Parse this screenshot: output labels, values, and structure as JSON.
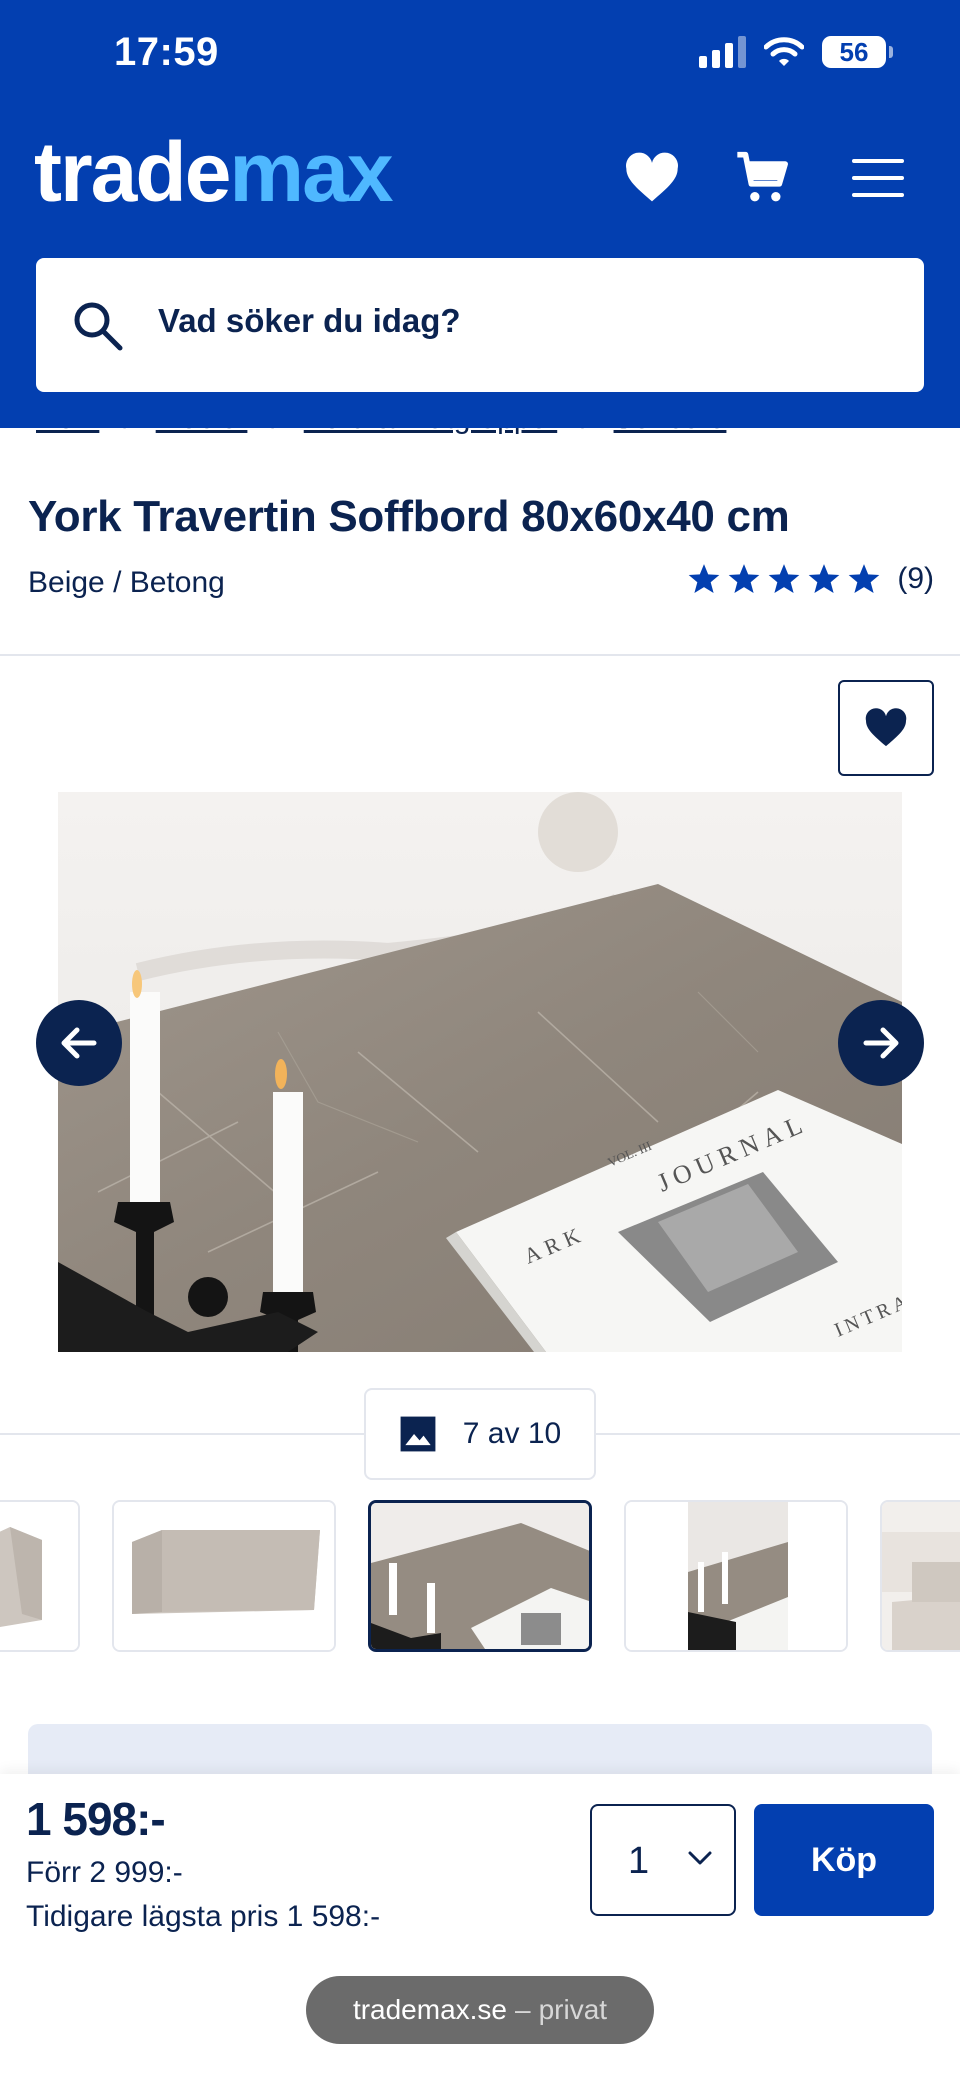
{
  "status_bar": {
    "time": "17:59",
    "battery": "56"
  },
  "header": {
    "logo_part1": "trade",
    "logo_part2": "max",
    "icons": [
      "heart-icon",
      "cart-icon",
      "menu-icon"
    ],
    "brand_color": "#033fb0",
    "accent_color": "#4fb8ff"
  },
  "search": {
    "placeholder": "Vad söker du idag?"
  },
  "breadcrumb": [
    "Hem",
    "Möbler",
    "Bord & matgrupper",
    "Soffbord"
  ],
  "product": {
    "title": "York Travertin Soffbord 80x60x40 cm",
    "variant": "Beige / Betong",
    "rating_stars": 5,
    "review_count": "(9)"
  },
  "gallery": {
    "counter": "7 av 10",
    "photo_text": {
      "vol": "VOL. III",
      "journal": "JOURNAL",
      "ark": "ARK",
      "intra": "INTRA"
    }
  },
  "purchase": {
    "price": "1 598:-",
    "previous_price": "Förr 2 999:-",
    "lowest_price": "Tidigare lägsta pris 1 598:-",
    "quantity": "1",
    "buy_label": "Köp"
  },
  "browser": {
    "domain": "trademax.se",
    "separator": "–",
    "mode": "privat"
  }
}
